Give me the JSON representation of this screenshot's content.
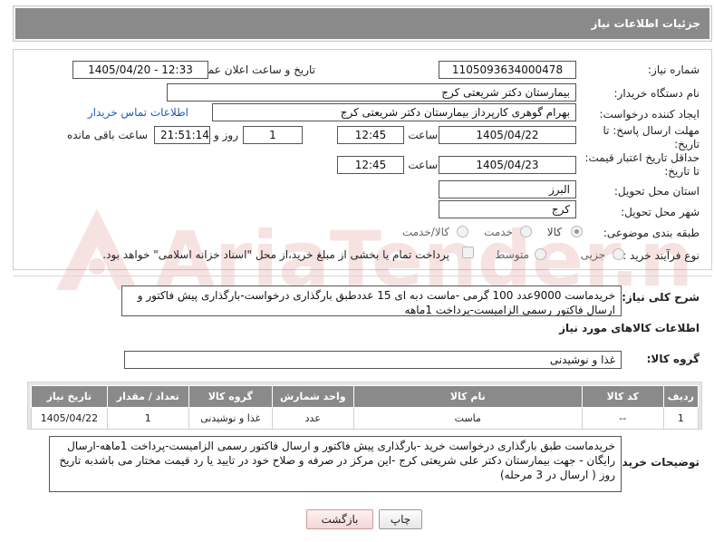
{
  "header": {
    "title": "جزئیات اطلاعات نیاز"
  },
  "form": {
    "need_number_label": "شماره نیاز:",
    "need_number": "1105093634000478",
    "announce_label": "تاریخ و ساعت اعلان عمومی:",
    "announce_value": "1405/04/20 - 12:33",
    "buyer_org_label": "نام دستگاه خریدار:",
    "buyer_org": "بیمارستان دکتر شریعتی کرج",
    "creator_label": "ایجاد کننده درخواست:",
    "creator": "بهرام گوهری کارپرداز بیمارستان دکتر شریعتی کرج",
    "contact_link": "اطلاعات تماس خریدار",
    "reply_deadline_label": "مهلت ارسال پاسخ: تا تاریخ:",
    "reply_date": "1405/04/22",
    "time_label": "ساعت",
    "reply_time": "12:45",
    "days_value": "1",
    "days_label": "روز و",
    "remaining_time": "21:51:14",
    "remaining_label": "ساعت باقی مانده",
    "price_validity_label": "حداقل تاریخ اعتبار قیمت: تا تاریخ:",
    "validity_date": "1405/04/23",
    "validity_time": "12:45",
    "province_label": "استان محل تحویل:",
    "province": "البرز",
    "city_label": "شهر محل تحویل:",
    "city": "کرج",
    "category_label": "طبقه بندی موضوعی:",
    "category_options": [
      "کالا",
      "خدمت",
      "کالا/خدمت"
    ],
    "process_label": "نوع فرآیند خرید :",
    "process_options": [
      "جزیی",
      "متوسط"
    ],
    "payment_note": "پرداخت تمام یا بخشی از مبلغ خرید،از محل \"اسناد خزانه اسلامی\" خواهد بود."
  },
  "description": {
    "label": "شرح کلی نیاز:",
    "text": "خریدماست 9000عدد 100 گرمی -ماست دبه ای 15 عددطبق بارگذاری درخواست-بارگذاری پیش فاکتور و ارسال فاکتور رسمی الزامیست-پرداخت 1ماهه"
  },
  "goods": {
    "section_title": "اطلاعات کالاهای مورد نیاز",
    "group_label": "گروه کالا:",
    "group_value": "غذا و نوشیدنی",
    "columns": [
      "ردیف",
      "کد کالا",
      "نام کالا",
      "واحد شمارش",
      "گروه کالا",
      "تعداد / مقدار",
      "تاریخ نیاز"
    ],
    "rows": [
      [
        "1",
        "--",
        "ماست",
        "عدد",
        "غذا و نوشیدنی",
        "1",
        "1405/04/22"
      ]
    ]
  },
  "buyer_notes": {
    "label": "توضیحات خریدار:",
    "text": "خریدماست  طبق بارگذاری درخواست خرید -بارگذاری پیش فاکتور و ارسال فاکتور رسمی الزامیست-پرداخت 1ماهه-ارسال رایگان - جهت بیمارستان دکتر علی شریعتی کرج -این مرکز در صرفه و صلاح خود در تایید یا رد قیمت مختار می باشدبه تاریخ روز ( ارسال در 3 مرحله)"
  },
  "buttons": {
    "print": "چاپ",
    "back": "بازگشت"
  },
  "watermark": {
    "text": "AriaTender.net"
  }
}
